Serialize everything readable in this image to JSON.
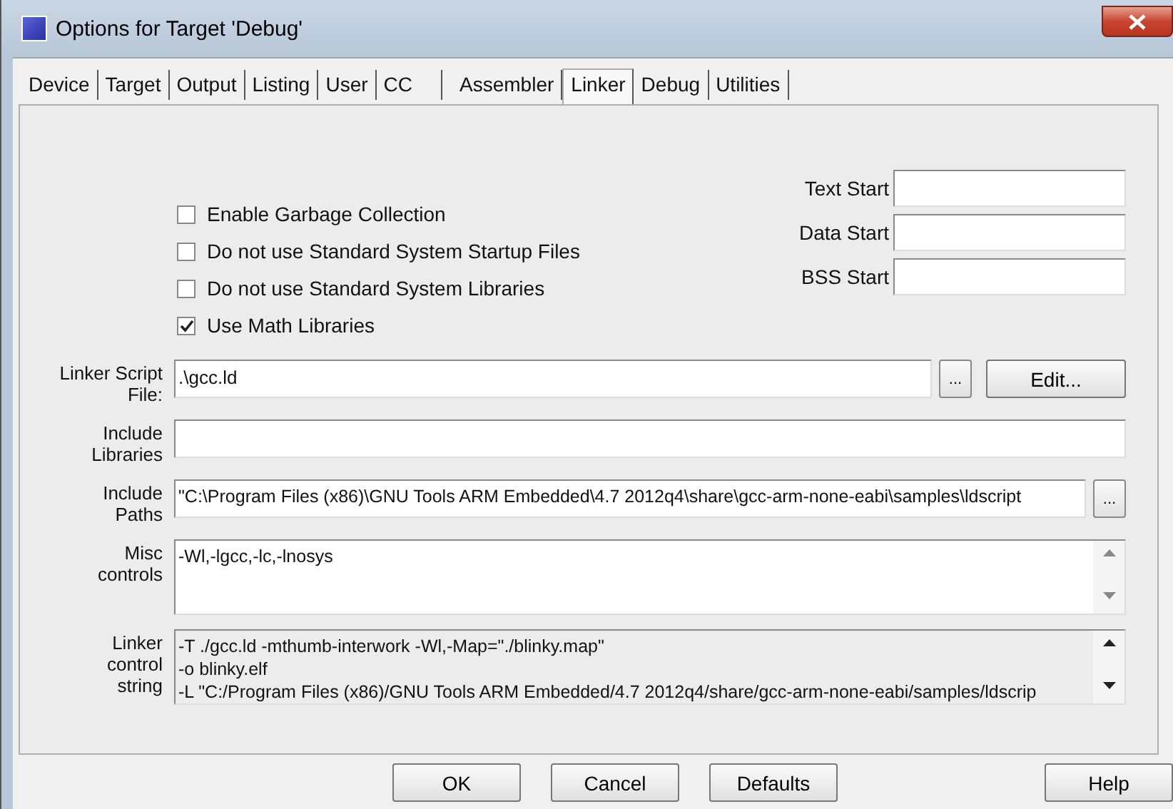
{
  "window": {
    "title": "Options for Target 'Debug'"
  },
  "tabs": [
    {
      "label": "Device",
      "selected": false
    },
    {
      "label": "Target",
      "selected": false
    },
    {
      "label": "Output",
      "selected": false
    },
    {
      "label": "Listing",
      "selected": false
    },
    {
      "label": "User",
      "selected": false
    },
    {
      "label": "CC",
      "selected": false
    },
    {
      "label": "Assembler",
      "selected": false
    },
    {
      "label": "Linker",
      "selected": true
    },
    {
      "label": "Debug",
      "selected": false
    },
    {
      "label": "Utilities",
      "selected": false
    }
  ],
  "options": [
    {
      "label": "Enable Garbage Collection",
      "checked": false
    },
    {
      "label": "Do not use Standard System Startup Files",
      "checked": false
    },
    {
      "label": "Do not use Standard System Libraries",
      "checked": false
    },
    {
      "label": "Use Math Libraries",
      "checked": true
    }
  ],
  "start_fields": [
    {
      "label": "Text Start"
    },
    {
      "label": "Data Start"
    },
    {
      "label": "BSS Start"
    }
  ],
  "linker_script_file": {
    "label": "Linker Script\nFile:",
    "value": ".\\gcc.ld",
    "browse": "...",
    "edit": "Edit..."
  },
  "include_libraries": {
    "label": "Include\nLibraries"
  },
  "include_paths": {
    "label": "Include\nPaths",
    "value": "\"C:\\Program Files (x86)\\GNU Tools ARM Embedded\\4.7 2012q4\\share\\gcc-arm-none-eabi\\samples\\ldscript",
    "browse": "..."
  },
  "misc_controls": {
    "label": "Misc\ncontrols",
    "lines": [
      "-Wl,-lgcc,-lc,-lnosys"
    ]
  },
  "linker_control_string": {
    "label": "Linker\ncontrol\nstring",
    "lines": [
      "-T ./gcc.ld -mthumb-interwork -Wl,-Map=\"./blinky.map\"",
      "-o blinky.elf",
      "-L \"C:/Program Files (x86)/GNU Tools ARM Embedded/4.7 2012q4/share/gcc-arm-none-eabi/samples/ldscrip"
    ]
  },
  "buttons": [
    {
      "label": "OK",
      "kind": "main"
    },
    {
      "label": "Cancel",
      "kind": "main"
    },
    {
      "label": "Defaults",
      "kind": "main"
    },
    {
      "label": "Help",
      "kind": "side"
    }
  ]
}
